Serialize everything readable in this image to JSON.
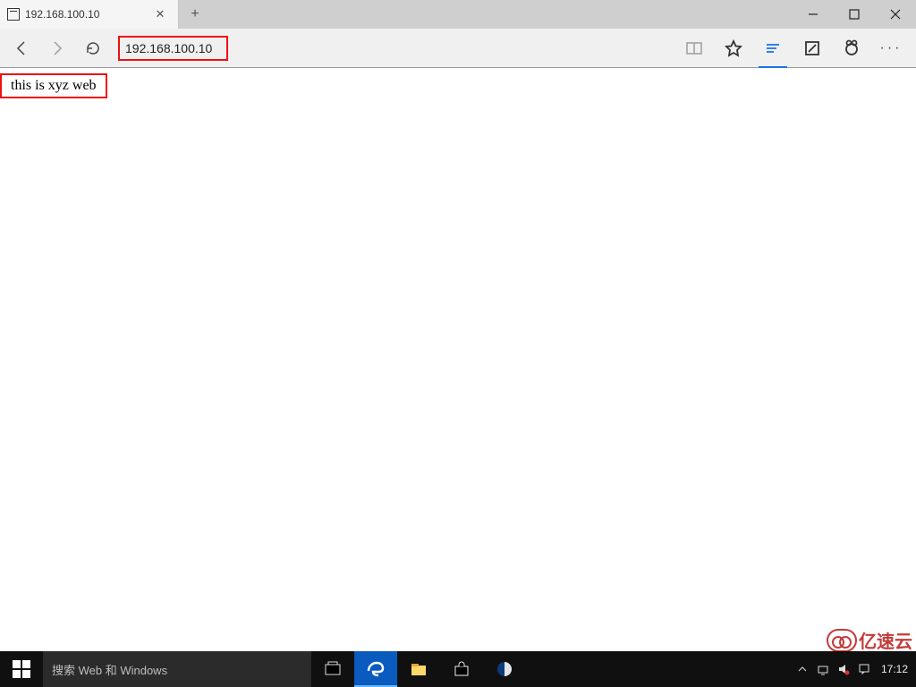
{
  "browser": {
    "tab": {
      "title": "192.168.100.10"
    },
    "address": "192.168.100.10",
    "page_text": "this is xyz web"
  },
  "taskbar": {
    "search_placeholder": "搜索 Web 和 Windows",
    "clock": "17:12"
  },
  "watermark": {
    "text": "亿速云"
  },
  "colors": {
    "highlight": "#e11",
    "active_blue": "#1e73e8"
  }
}
